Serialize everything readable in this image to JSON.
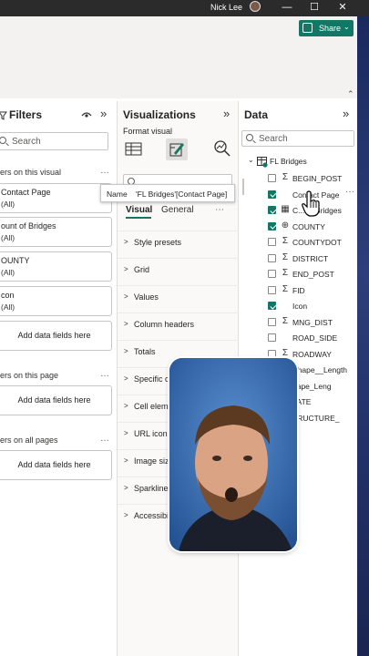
{
  "titlebar": {
    "user_name": "Nick Lee",
    "minimize": "—",
    "maximize": "☐",
    "close": "✕"
  },
  "ribbon": {
    "share_label": "Share",
    "share_chevron": "⌄",
    "collapse": "⌃"
  },
  "filters": {
    "title": "Filters",
    "eye_icon": "eye-icon",
    "collapse": "»",
    "search_placeholder": "Search",
    "on_this_visual_label": "ers on this visual",
    "more": "…",
    "cards": [
      {
        "title": "Contact Page",
        "state": "(All)"
      },
      {
        "title": "ount of Bridges",
        "state": "(All)"
      },
      {
        "title": "OUNTY",
        "state": "(All)"
      },
      {
        "title": "con",
        "state": "(All)"
      }
    ],
    "add_fields": "Add data fields here",
    "on_this_page_label": "ers on this page",
    "on_all_pages_label": "ers on all pages"
  },
  "viz": {
    "title": "Visualizations",
    "collapse": "»",
    "format_visual_label": "Format visual",
    "tabs": {
      "visual": "Visual",
      "general": "General",
      "more": "⋯"
    },
    "sections": [
      "Style presets",
      "Grid",
      "Values",
      "Column headers",
      "Totals",
      "Specific c",
      "Cell elem",
      "URL icon",
      "Image siz",
      "Sparkline",
      "Accessibil"
    ]
  },
  "tooltip": {
    "name_key": "Name",
    "name_value": "'FL Bridges'[Contact Page]"
  },
  "data": {
    "title": "Data",
    "collapse": "»",
    "search_placeholder": "Search",
    "table_name": "FL Bridges",
    "more": "···",
    "fields": [
      {
        "name": "BEGIN_POST",
        "checked": false,
        "type": "Σ"
      },
      {
        "name": "Contact Page",
        "checked": true,
        "type": ""
      },
      {
        "name": "C... of Bridges",
        "checked": true,
        "type": "▦"
      },
      {
        "name": "COUNTY",
        "checked": true,
        "type": "⊕"
      },
      {
        "name": "COUNTYDOT",
        "checked": false,
        "type": "Σ"
      },
      {
        "name": "DISTRICT",
        "checked": false,
        "type": "Σ"
      },
      {
        "name": "END_POST",
        "checked": false,
        "type": "Σ"
      },
      {
        "name": "FID",
        "checked": false,
        "type": "Σ"
      },
      {
        "name": "Icon",
        "checked": true,
        "type": ""
      },
      {
        "name": "MNG_DIST",
        "checked": false,
        "type": "Σ"
      },
      {
        "name": "ROAD_SIDE",
        "checked": false,
        "type": ""
      },
      {
        "name": "ROADWAY",
        "checked": false,
        "type": "Σ"
      },
      {
        "name": "Shape__Length",
        "checked": false,
        "type": ""
      },
      {
        "name": "hape_Leng",
        "checked": false,
        "type": ""
      },
      {
        "name": "TATE",
        "checked": false,
        "type": ""
      },
      {
        "name": "TRUCTURE_",
        "checked": false,
        "type": ""
      }
    ]
  },
  "colors": {
    "accent": "#117865",
    "titlebar": "#2b2b2b",
    "pane_bg": "#faf9f8"
  }
}
